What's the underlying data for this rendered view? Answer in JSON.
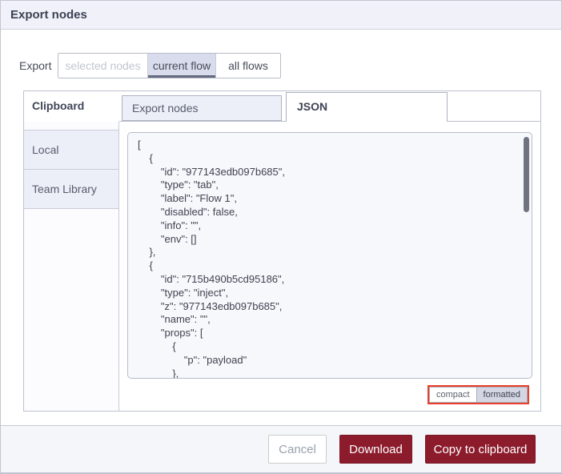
{
  "dialog": {
    "title": "Export nodes"
  },
  "export_row": {
    "label": "Export",
    "options": [
      {
        "label": "selected nodes",
        "state": "disabled"
      },
      {
        "label": "current flow",
        "state": "selected"
      },
      {
        "label": "all flows",
        "state": "normal"
      }
    ]
  },
  "panel": {
    "clipboard_tab": "Clipboard",
    "tabs": [
      {
        "label": "Export nodes",
        "active": false
      },
      {
        "label": "JSON",
        "active": true
      }
    ],
    "sidebar": {
      "items": [
        "Local",
        "Team Library"
      ]
    },
    "code": "[\n    {\n        \"id\": \"977143edb097b685\",\n        \"type\": \"tab\",\n        \"label\": \"Flow 1\",\n        \"disabled\": false,\n        \"info\": \"\",\n        \"env\": []\n    },\n    {\n        \"id\": \"715b490b5cd95186\",\n        \"type\": \"inject\",\n        \"z\": \"977143edb097b685\",\n        \"name\": \"\",\n        \"props\": [\n            {\n                \"p\": \"payload\"\n            },",
    "format_toggle": {
      "compact_label": "compact",
      "formatted_label": "formatted",
      "selected": "formatted",
      "highlight_color": "#e8402a"
    }
  },
  "footer": {
    "cancel_label": "Cancel",
    "download_label": "Download",
    "copy_label": "Copy to clipboard"
  },
  "colors": {
    "primary_button": "#8c1c2c",
    "tab_inactive_bg": "#edeff8",
    "selected_segment_bg": "#d9dcec",
    "header_bg": "#f1f2f9",
    "annotation_red": "#e8402a"
  }
}
